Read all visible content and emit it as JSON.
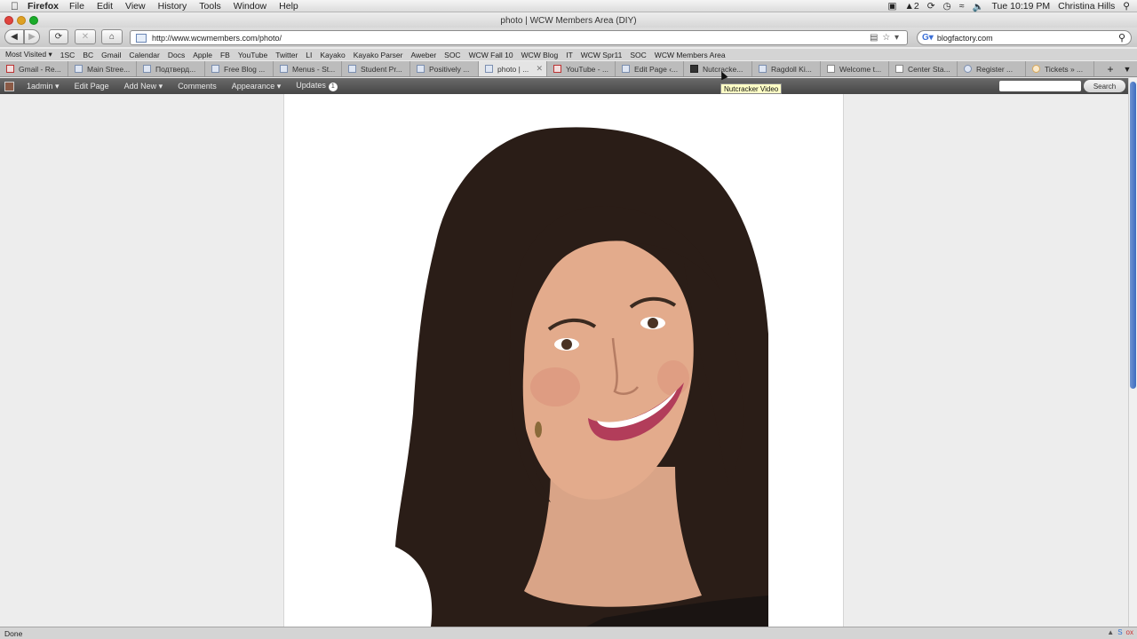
{
  "os_menubar": {
    "app_name": "Firefox",
    "menus": [
      "File",
      "Edit",
      "View",
      "History",
      "Tools",
      "Window",
      "Help"
    ],
    "battery_text": "2",
    "clock": "Tue 10:19 PM",
    "user": "Christina Hills"
  },
  "window": {
    "title": "photo | WCW Members Area (DIY)"
  },
  "navigation": {
    "url": "http://www.wcwmembers.com/photo/",
    "search_engine_value": "blogfactory.com"
  },
  "bookmarks_bar": {
    "items": [
      "Most Visited ▾",
      "1SC",
      "BC",
      "Gmail",
      "Calendar",
      "Docs",
      "Apple",
      "FB",
      "YouTube",
      "Twitter",
      "LI",
      "Kayako",
      "Kayako Parser",
      "Aweber",
      "SOC",
      "WCW Fall 10",
      "WCW Blog",
      "IT",
      "WCW Spr11",
      "SOC",
      "WCW Members Area"
    ]
  },
  "tabs": [
    {
      "label": "Gmail - Re...",
      "icon": "gmail-icon"
    },
    {
      "label": "Main Stree...",
      "icon": "search-icon"
    },
    {
      "label": "Подтверд...",
      "icon": "grid-icon"
    },
    {
      "label": "Free Blog ...",
      "icon": "php-icon"
    },
    {
      "label": "Menus - St...",
      "icon": "grid-icon"
    },
    {
      "label": "Student Pr...",
      "icon": "grid-icon"
    },
    {
      "label": "Positively ...",
      "icon": "grid-icon"
    },
    {
      "label": "photo | ...",
      "icon": "grid-icon",
      "active": true
    },
    {
      "label": "YouTube - ...",
      "icon": "youtube-icon"
    },
    {
      "label": "Edit Page ‹...",
      "icon": "grid-icon"
    },
    {
      "label": "Nutcracke...",
      "icon": "dark-icon"
    },
    {
      "label": "Ragdoll Ki...",
      "icon": "grid-icon"
    },
    {
      "label": "Welcome t...",
      "icon": "doc-icon"
    },
    {
      "label": "Center Sta...",
      "icon": "doc-icon"
    },
    {
      "label": "Register ...",
      "icon": "dot-icon"
    },
    {
      "label": "Tickets » ...",
      "icon": "dot-icon"
    }
  ],
  "tooltip": "Nutcracker Video",
  "admin_bar": {
    "user": "1admin",
    "edit_page": "Edit Page",
    "add_new": "Add New",
    "comments": "Comments",
    "appearance": "Appearance",
    "updates": "Updates",
    "updates_count": "1",
    "search_button": "Search"
  },
  "status_bar": {
    "text": "Done"
  },
  "colors": {
    "admin_bar": "#464646",
    "scroll_thumb": "#3e6cc0",
    "page_bg": "#ffffff"
  }
}
